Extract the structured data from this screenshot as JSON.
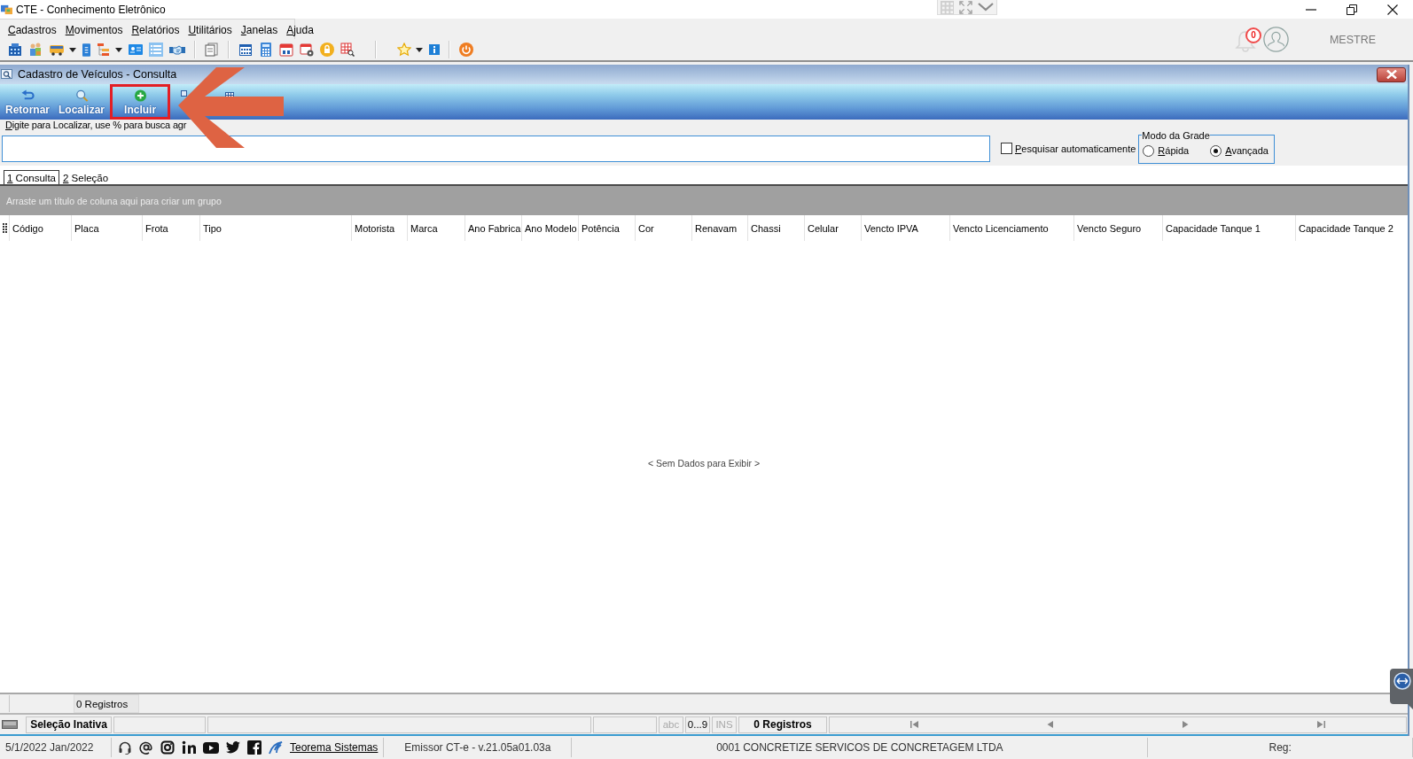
{
  "window": {
    "title": "CTE - Conhecimento Eletrônico"
  },
  "menu": [
    "Cadastros",
    "Movimentos",
    "Relatórios",
    "Utilitários",
    "Janelas",
    "Ajuda"
  ],
  "notifications": {
    "count": "0"
  },
  "user": {
    "name": "MESTRE"
  },
  "child_window": {
    "title": "Cadastro de Veículos - Consulta",
    "buttons": [
      {
        "label": "Retornar",
        "highlighted": false
      },
      {
        "label": "Localizar",
        "highlighted": false
      },
      {
        "label": "Incluir",
        "highlighted": true
      }
    ]
  },
  "search": {
    "hint": "Digite para Localizar, use % para busca agr"
  },
  "auto_search": {
    "label": "Pesquisar automaticamente",
    "checked": false
  },
  "grid_mode": {
    "title": "Modo da Grade",
    "options": [
      {
        "label": "Rápida",
        "selected": false
      },
      {
        "label": "Avançada",
        "selected": true
      }
    ]
  },
  "tabs": [
    {
      "label": "1 Consulta",
      "selected": true
    },
    {
      "label": "2 Seleção",
      "selected": false
    }
  ],
  "group_panel": {
    "hint": "Arraste um título de coluna aqui para criar um grupo"
  },
  "table": {
    "columns": [
      "Código",
      "Placa",
      "Frota",
      "Tipo",
      "Motorista",
      "Marca",
      "Ano Fabrica",
      "Ano Modelo",
      "Potência",
      "Cor",
      "Renavam",
      "Chassi",
      "Celular",
      "Vencto IPVA",
      "Vencto Licenciamento",
      "Vencto Seguro",
      "Capacidade Tanque 1",
      "Capacidade Tanque 2"
    ],
    "empty_message": "< Sem Dados para Exibir >"
  },
  "footer": {
    "count": "0 Registros"
  },
  "status_bar": {
    "selection": "Seleção Inativa",
    "indicators": [
      {
        "label": "abc",
        "active": false
      },
      {
        "label": "0...9",
        "active": true
      },
      {
        "label": "INS",
        "active": false
      }
    ],
    "records": "0 Registros"
  },
  "bottom_bar": {
    "date": "5/1/2022 Jan/2022",
    "link": "Teorema Sistemas",
    "version": "Emissor CT-e - v.21.05a01.03a",
    "company": "0001 CONCRETIZE SERVICOS DE CONCRETAGEM LTDA",
    "reg": "Reg:"
  }
}
